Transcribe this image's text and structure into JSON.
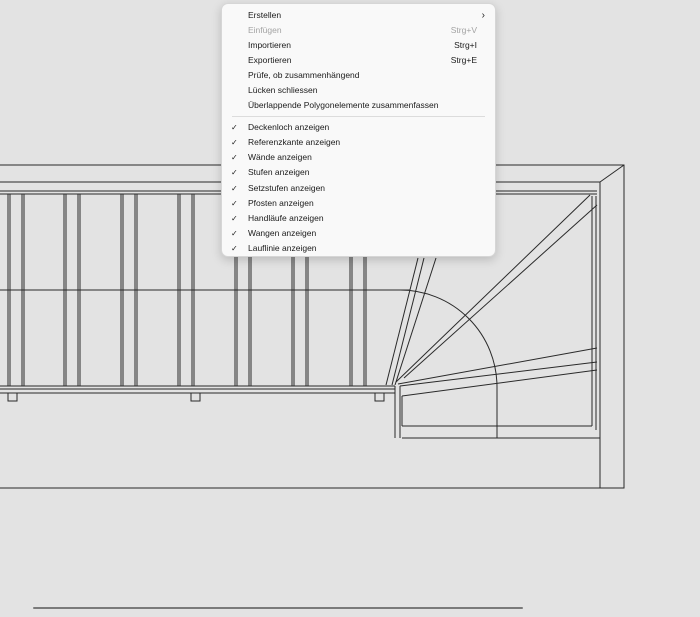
{
  "context_menu": {
    "items": [
      {
        "label": "Erstellen",
        "shortcut": "",
        "submenu": true,
        "checked": false,
        "disabled": false
      },
      {
        "label": "Einfügen",
        "shortcut": "Strg+V",
        "submenu": false,
        "checked": false,
        "disabled": true
      },
      {
        "label": "Importieren",
        "shortcut": "Strg+I",
        "submenu": false,
        "checked": false,
        "disabled": false
      },
      {
        "label": "Exportieren",
        "shortcut": "Strg+E",
        "submenu": false,
        "checked": false,
        "disabled": false
      },
      {
        "label": "Prüfe, ob zusammenhängend",
        "shortcut": "",
        "submenu": false,
        "checked": false,
        "disabled": false
      },
      {
        "label": "Lücken schliessen",
        "shortcut": "",
        "submenu": false,
        "checked": false,
        "disabled": false
      },
      {
        "label": "Überlappende Polygonelemente zusammenfassen",
        "shortcut": "",
        "submenu": false,
        "checked": false,
        "disabled": false
      },
      {
        "label": "Deckenloch anzeigen",
        "shortcut": "",
        "submenu": false,
        "checked": true,
        "disabled": false
      },
      {
        "label": "Referenzkante anzeigen",
        "shortcut": "",
        "submenu": false,
        "checked": true,
        "disabled": false
      },
      {
        "label": "Wände anzeigen",
        "shortcut": "",
        "submenu": false,
        "checked": true,
        "disabled": false
      },
      {
        "label": "Stufen anzeigen",
        "shortcut": "",
        "submenu": false,
        "checked": true,
        "disabled": false
      },
      {
        "label": "Setzstufen anzeigen",
        "shortcut": "",
        "submenu": false,
        "checked": true,
        "disabled": false
      },
      {
        "label": "Pfosten anzeigen",
        "shortcut": "",
        "submenu": false,
        "checked": true,
        "disabled": false
      },
      {
        "label": "Handläufe anzeigen",
        "shortcut": "",
        "submenu": false,
        "checked": true,
        "disabled": false
      },
      {
        "label": "Wangen anzeigen",
        "shortcut": "",
        "submenu": false,
        "checked": true,
        "disabled": false
      },
      {
        "label": "Lauflinie anzeigen",
        "shortcut": "",
        "submenu": false,
        "checked": true,
        "disabled": false
      }
    ],
    "check_glyph": "✓",
    "submenu_glyph": "›"
  },
  "colors": {
    "canvas_background": "#e3e3e3",
    "drawing_line": "#2a2a2a",
    "menu_background": "#f9f9f9",
    "scrollbar": "#7a7a7a"
  }
}
